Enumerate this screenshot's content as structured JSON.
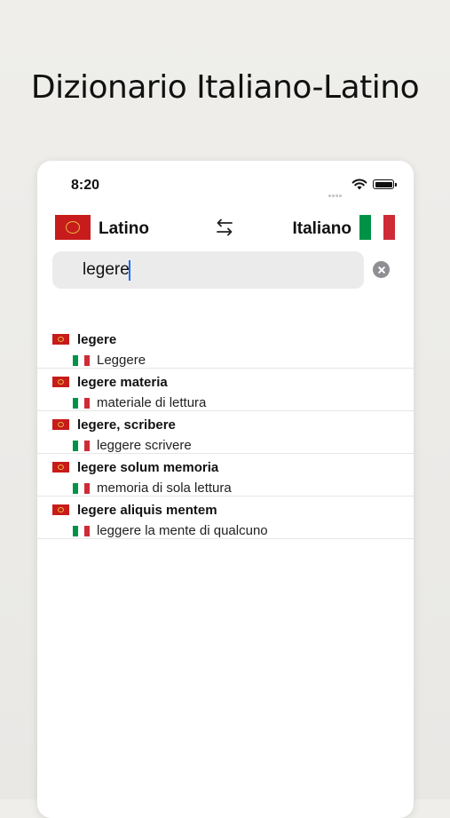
{
  "headline": "Dizionario Italiano-Latino",
  "status_bar": {
    "time": "8:20"
  },
  "languages": {
    "source": "Latino",
    "target": "Italiano"
  },
  "search": {
    "value": "legere"
  },
  "results": [
    {
      "latin": "legere",
      "italian": "Leggere"
    },
    {
      "latin": "legere materia",
      "italian": "materiale di lettura"
    },
    {
      "latin": "legere, scribere",
      "italian": "leggere scrivere"
    },
    {
      "latin": "legere solum memoria",
      "italian": "memoria di sola lettura"
    },
    {
      "latin": "legere aliquis mentem",
      "italian": "leggere la mente di qualcuno"
    }
  ],
  "icons": {
    "swap": "swap-arrows-icon",
    "clear": "clear-icon",
    "wifi": "wifi-icon",
    "battery": "battery-icon",
    "latin_flag": "latin-flag-icon",
    "italian_flag": "italian-flag-icon"
  },
  "colors": {
    "caret": "#1a6ef5",
    "latin_flag": "#c81b1b",
    "italian_green": "#009246",
    "italian_red": "#ce2b37"
  }
}
